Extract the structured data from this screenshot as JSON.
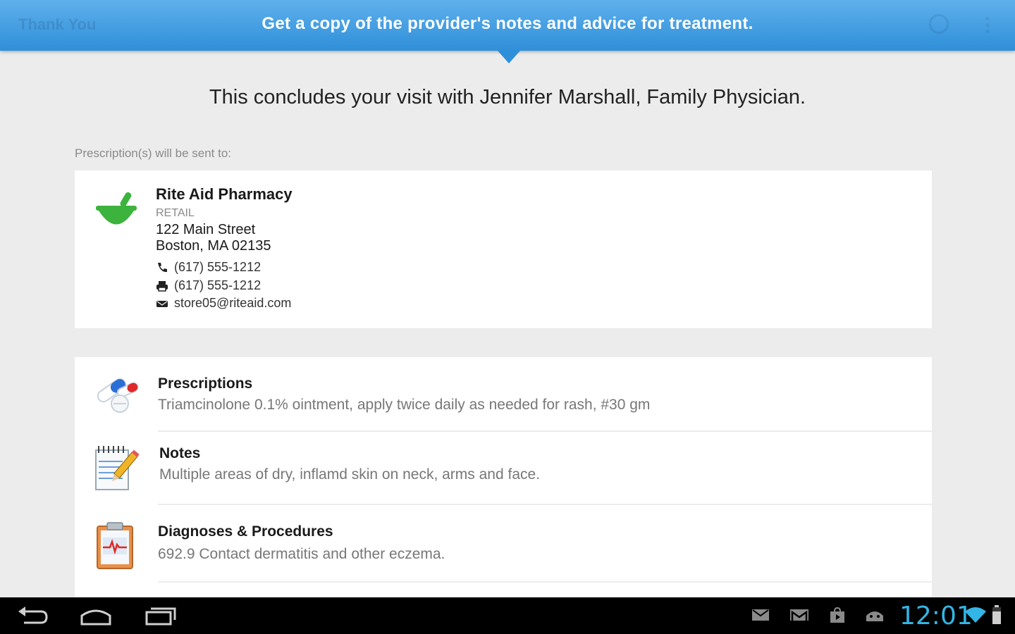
{
  "header": {
    "ghost_title": "Thank You",
    "banner": "Get a copy of the provider's notes and advice for treatment."
  },
  "headline": "This concludes your visit with Jennifer Marshall, Family Physician.",
  "sent_label": "Prescription(s) will be sent to:",
  "pharmacy": {
    "name": "Rite Aid Pharmacy",
    "type": "RETAIL",
    "address1": "122 Main Street",
    "address2": "Boston, MA 02135",
    "phone": "(617) 555-1212",
    "fax": "(617) 555-1212",
    "email": "store05@riteaid.com",
    "icon": "mortar-pestle-icon"
  },
  "sections": [
    {
      "title": "Prescriptions",
      "desc": "Triamcinolone 0.1% ointment, apply twice daily as needed for rash, #30 gm",
      "icon": "pills-icon"
    },
    {
      "title": "Notes",
      "desc": "Multiple areas of dry, inflamd skin on neck, arms and face.",
      "icon": "notepad-icon"
    },
    {
      "title": "Diagnoses & Procedures",
      "desc": "692.9 Contact dermatitis and other eczema.",
      "icon": "clipboard-icon"
    }
  ],
  "system_bar": {
    "time": "12:01",
    "icons": [
      "back-icon",
      "home-icon",
      "recent-apps-icon",
      "mail-icon",
      "gmail-icon",
      "store-icon",
      "android-icon",
      "wifi-icon",
      "battery-icon"
    ]
  },
  "colors": {
    "banner": "#2f8fd8",
    "clock": "#33b5e5",
    "mortar": "#3cb33c"
  }
}
